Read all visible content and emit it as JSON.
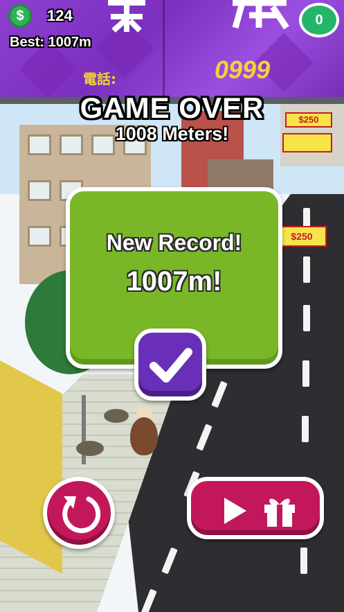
{
  "hud": {
    "coin_symbol": "$",
    "coins": "124",
    "best": "Best: 1007m",
    "gems": "0"
  },
  "billboard": {
    "label": "電話:",
    "number": "0999"
  },
  "signs": {
    "price_1": "$250",
    "price_2": "$250"
  },
  "game_over": {
    "title": "GAME OVER",
    "distance": "1008 Meters!"
  },
  "record_panel": {
    "title": "New Record!",
    "value": "1007m!"
  },
  "buttons": {
    "confirm_icon": "checkmark-icon",
    "restart_icon": "restart-icon",
    "continue_icons": [
      "play-icon",
      "gift-icon"
    ]
  },
  "colors": {
    "panel_green": "#79b728",
    "confirm_purple": "#6a2fb8",
    "button_pink": "#c2185b",
    "billboard_purple": "#8e3fd0",
    "gem_green": "#25b56a"
  }
}
